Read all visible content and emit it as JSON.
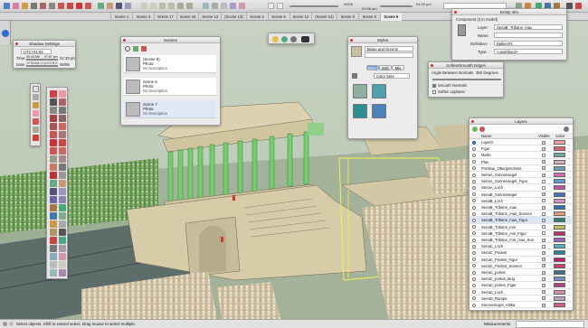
{
  "top_toolbar": {
    "date": "06/05",
    "time_left": "09:56 am",
    "time_right": "04:33 pm"
  },
  "scene_tabs": [
    "Scene 1",
    "Scene 4",
    "Scene 17",
    "Scene 16",
    "Scene 13",
    "(Scene 13)",
    "Scene 2",
    "Scene 5",
    "Scene 12",
    "(Scene 14)",
    "Scene 9",
    "Scene 5",
    "Scene 6"
  ],
  "active_scene_tab": 12,
  "shadow_settings": {
    "title": "Shadow Settings",
    "utc": "UTC+01:00",
    "time_label": "Time:",
    "time_from": "06:43 AM",
    "time_to": "07:57 pm",
    "time_value": "04:33 pm",
    "date_label": "Date:",
    "months": "J F M A M J J A S O N D",
    "date_value": "06/05"
  },
  "scenes_panel": {
    "title": "Scenes",
    "items": [
      {
        "name": "(Scene 9)",
        "photo": "Photo:",
        "desc": "No Description"
      },
      {
        "name": "Scene 5",
        "photo": "Photo:",
        "desc": "No Description"
      },
      {
        "name": "Scene 7",
        "photo": "Photo:",
        "desc": "No Description"
      }
    ]
  },
  "styles_panel": {
    "title": "Styles",
    "style_name": "Beige and Green2",
    "tabs": [
      "Select",
      "Edit",
      "Mix"
    ],
    "dropdown": "Color Sets"
  },
  "entity_info": {
    "title": "Entity Info",
    "component": "Component (3 in model)",
    "layer_label": "Layer:",
    "layer_value": "SeriaB_Tribüne_max",
    "name_label": "Name:",
    "definition_label": "Definition:",
    "definition_value": "Balken#3",
    "type_label": "Type:",
    "type_value": "<undefined>"
  },
  "soften_edges": {
    "title": "Soften/Smooth Edges",
    "angle_label": "Angle Between Normals",
    "angle_value": "350 Degrees",
    "smooth_label": "Smooth Normals",
    "soften_label": "Soften coplanar"
  },
  "layers_panel": {
    "title": "Layers",
    "col_name": "Name",
    "col_visible": "Visible",
    "col_color": "Color",
    "rows": [
      {
        "name": "Layer0",
        "current": true,
        "visible": true,
        "color": "#f0a0a0"
      },
      {
        "name": "Figur",
        "current": false,
        "visible": true,
        "color": "#e06070"
      },
      {
        "name": "Maße",
        "current": false,
        "visible": false,
        "color": "#6fa8a0"
      },
      {
        "name": "Plan",
        "current": false,
        "visible": true,
        "color": "#d8b0b8"
      },
      {
        "name": "Portikus_Obergeschoss",
        "current": false,
        "visible": true,
        "color": "#6fa0b0"
      },
      {
        "name": "SeriaA_Sonnensegel",
        "current": false,
        "visible": true,
        "color": "#d070b0"
      },
      {
        "name": "SeriaA_Sonnensegel_Figur",
        "current": false,
        "visible": false,
        "color": "#5a9ad0"
      },
      {
        "name": "SeriaA_Loch",
        "current": false,
        "visible": false,
        "color": "#c050a0"
      },
      {
        "name": "SeriaB_Sonnensegel",
        "current": false,
        "visible": true,
        "color": "#4a70c0"
      },
      {
        "name": "SeriaB_Loch",
        "current": false,
        "visible": false,
        "color": "#e090c0"
      },
      {
        "name": "SeriaB_Tribüne_max",
        "current": false,
        "visible": true,
        "color": "#3070b0"
      },
      {
        "name": "SeriaB_Tribüne_max_Sonnen",
        "current": false,
        "visible": false,
        "color": "#e0a070"
      },
      {
        "name": "SeriaB_Tribüne_max_Figur",
        "current": false,
        "visible": true,
        "color": "#2e8070"
      },
      {
        "name": "SeriaB_Tribüne_min",
        "current": false,
        "visible": false,
        "color": "#c0c060"
      },
      {
        "name": "SeriaB_Tribüne_min_Figur",
        "current": false,
        "visible": false,
        "color": "#c03070"
      },
      {
        "name": "SeriaB_Tribüne_min_max_Son",
        "current": false,
        "visible": true,
        "color": "#a060c0"
      },
      {
        "name": "SeriaC_Loch",
        "current": false,
        "visible": false,
        "color": "#50b0c0"
      },
      {
        "name": "SeriaC_Podest",
        "current": false,
        "visible": true,
        "color": "#3080a0"
      },
      {
        "name": "SeriaC_Podest_Figur",
        "current": false,
        "visible": true,
        "color": "#c02070"
      },
      {
        "name": "SeriaC_Podest_Sonnen",
        "current": false,
        "visible": true,
        "color": "#d04070"
      },
      {
        "name": "SeriaC_portes",
        "current": false,
        "visible": true,
        "color": "#407080"
      },
      {
        "name": "SeriaC_portes_lang",
        "current": false,
        "visible": true,
        "color": "#7090c0"
      },
      {
        "name": "SeriaC_portes_Figur",
        "current": false,
        "visible": true,
        "color": "#b04080"
      },
      {
        "name": "SeriaC_Loch",
        "current": false,
        "visible": true,
        "color": "#d090a0"
      },
      {
        "name": "SeriaD_Rampe",
        "current": false,
        "visible": true,
        "color": "#c0a0c0"
      },
      {
        "name": "Sonnensegel_Attika",
        "current": false,
        "visible": true,
        "color": "#d06080"
      }
    ]
  },
  "status_bar": {
    "message": "Select objects. Shift to extend select. Drag mouse to select multiple.",
    "measurements_label": "Measurements"
  },
  "colors": {
    "sky": "#c3cdbd",
    "ground": "#8da48f",
    "building": "#d7ccaa",
    "column": "#6ed46a",
    "selection": "#f2f24a"
  }
}
